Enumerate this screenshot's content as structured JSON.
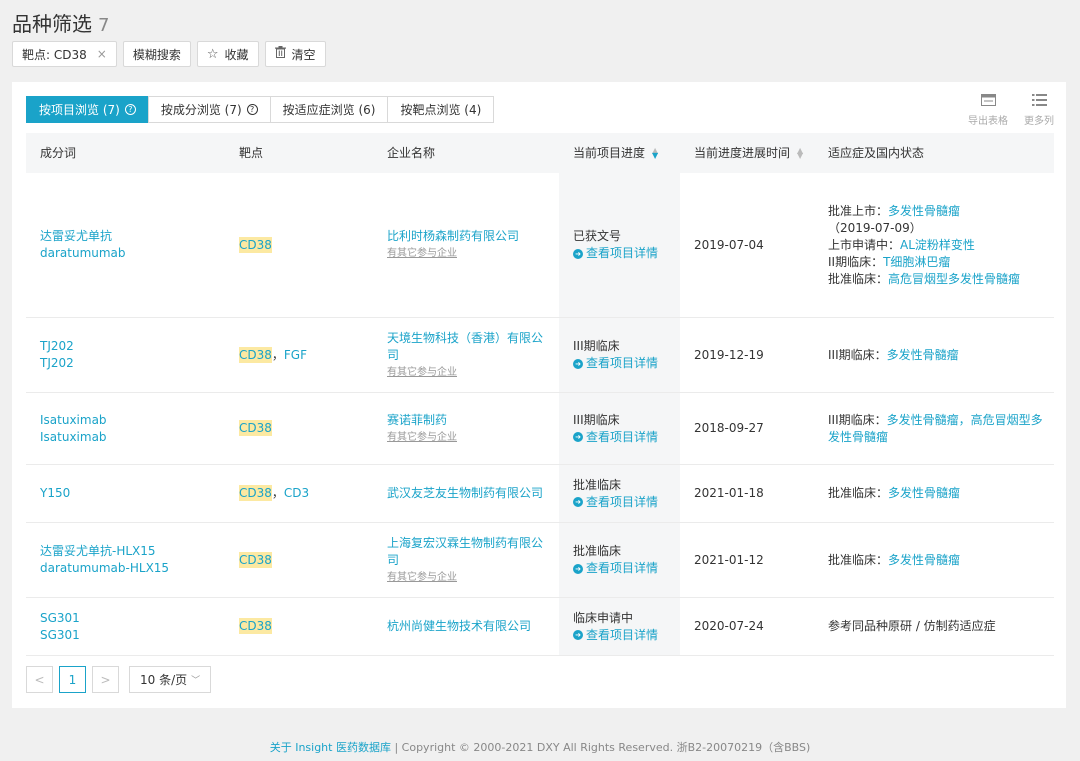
{
  "page": {
    "title": "品种筛选",
    "count": "7"
  },
  "toolbar": {
    "filter_tag": "靶点: CD38",
    "filter_close": "×",
    "fuzzy": "模糊搜索",
    "favorite": "收藏",
    "clear": "清空"
  },
  "tabs": [
    {
      "label": "按项目浏览 (7)",
      "has_help": true
    },
    {
      "label": "按成分浏览 (7)",
      "has_help": true
    },
    {
      "label": "按适应症浏览 (6)",
      "has_help": false
    },
    {
      "label": "按靶点浏览 (4)",
      "has_help": false
    }
  ],
  "tools": {
    "export": "导出表格",
    "more": "更多列"
  },
  "columns": [
    "成分词",
    "靶点",
    "企业名称",
    "当前项目进度",
    "当前进度进展时间",
    "适应症及国内状态"
  ],
  "detail_label": "查看项目详情",
  "rows": [
    {
      "name1": "达雷妥尤单抗",
      "name2": "daratumumab",
      "target": "CD38",
      "target_extra": "",
      "company": "比利时杨森制药有限公司",
      "company_sub": "有其它参与企业",
      "stage": "已获文号",
      "date": "2019-07-04",
      "ind": [
        {
          "label": "批准上市：",
          "val": "多发性骨髓瘤",
          "tail": "（2019-07-09）"
        },
        {
          "label": "上市申请中：",
          "val": "AL淀粉样变性",
          "tail": ""
        },
        {
          "label": "II期临床：",
          "val": "T细胞淋巴瘤",
          "tail": ""
        },
        {
          "label": "批准临床：",
          "val": "高危冒烟型多发性骨髓瘤",
          "tail": ""
        }
      ]
    },
    {
      "name1": "TJ202",
      "name2": "TJ202",
      "target": "CD38",
      "target_extra": "FGF",
      "company": "天境生物科技（香港）有限公司",
      "company_sub": "有其它参与企业",
      "stage": "III期临床",
      "date": "2019-12-19",
      "ind": [
        {
          "label": "III期临床：",
          "val": "多发性骨髓瘤",
          "tail": ""
        }
      ]
    },
    {
      "name1": "Isatuximab",
      "name2": "Isatuximab",
      "target": "CD38",
      "target_extra": "",
      "company": "赛诺菲制药",
      "company_sub": "有其它参与企业",
      "stage": "III期临床",
      "date": "2018-09-27",
      "ind": [
        {
          "label": "III期临床：",
          "val": "多发性骨髓瘤，高危冒烟型多发性骨髓瘤",
          "tail": ""
        }
      ]
    },
    {
      "name1": "Y150",
      "name2": "",
      "target": "CD38",
      "target_extra": "CD3",
      "company": "武汉友芝友生物制药有限公司",
      "company_sub": "",
      "stage": "批准临床",
      "date": "2021-01-18",
      "ind": [
        {
          "label": "批准临床：",
          "val": "多发性骨髓瘤",
          "tail": ""
        }
      ]
    },
    {
      "name1": "达雷妥尤单抗-HLX15",
      "name2": "daratumumab-HLX15",
      "target": "CD38",
      "target_extra": "",
      "company": "上海复宏汉霖生物制药有限公司",
      "company_sub": "有其它参与企业",
      "stage": "批准临床",
      "date": "2021-01-12",
      "ind": [
        {
          "label": "批准临床：",
          "val": "多发性骨髓瘤",
          "tail": ""
        }
      ]
    },
    {
      "name1": "SG301",
      "name2": "SG301",
      "target": "CD38",
      "target_extra": "",
      "company": "杭州尚健生物技术有限公司",
      "company_sub": "",
      "stage": "临床申请中",
      "date": "2020-07-24",
      "ind": [
        {
          "label": "",
          "val": "",
          "tail": "参考同品种原研 / 仿制药适应症"
        }
      ]
    }
  ],
  "pager": {
    "current": "1",
    "prev": "<",
    "next": ">",
    "size": "10 条/页"
  },
  "footer": {
    "about": "关于 Insight 医药数据库",
    "copyright": " | Copyright © 2000-2021 DXY All Rights Reserved. 浙B2-20070219（含BBS)"
  },
  "colors": {
    "accent": "#1aa3c9",
    "highlight": "#fce9a2"
  }
}
